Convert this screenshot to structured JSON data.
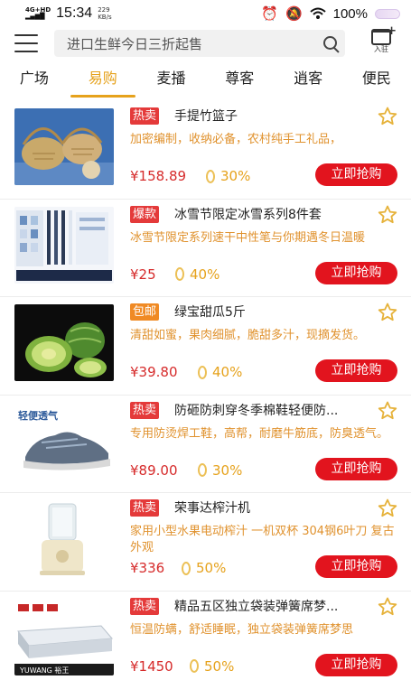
{
  "status_bar": {
    "network": "4G+HD",
    "time": "15:34",
    "speed_value": "229",
    "speed_unit": "KB/s",
    "battery": "100%"
  },
  "header": {
    "search_placeholder": "进口生鲜今日三折起售",
    "join_label": "入驻"
  },
  "tabs": [
    {
      "label": "广场"
    },
    {
      "label": "易购"
    },
    {
      "label": "麦播"
    },
    {
      "label": "尊客"
    },
    {
      "label": "逍客"
    },
    {
      "label": "便民"
    }
  ],
  "active_tab": "易购",
  "colors": {
    "accent": "#e6a21c",
    "buy_button": "#e2141e",
    "price": "#d62b2b",
    "badge_red": "#e43a3a",
    "badge_orange": "#f08a24"
  },
  "buy_label": "立即抢购",
  "products": [
    {
      "badge": "热卖",
      "title": "手提竹篮子",
      "desc": "加密编制，收纳必备，农村纯手工礼品，",
      "price": "¥158.89",
      "rate": "30%"
    },
    {
      "badge": "爆款",
      "title": "冰雪节限定冰雪系列8件套",
      "desc": "冰雪节限定系列速干中性笔与你期遇冬日温暖",
      "price": "¥25",
      "rate": "40%"
    },
    {
      "badge": "包邮",
      "title": "绿宝甜瓜5斤",
      "desc": "清甜如蜜，果肉细腻，脆甜多汁，现摘发货。",
      "price": "¥39.80",
      "rate": "40%"
    },
    {
      "badge": "热卖",
      "title": "防砸防刺穿冬季棉鞋轻便防...",
      "desc": "专用防烫焊工鞋，高帮，耐磨牛筋底，防臭透气。",
      "price": "¥89.00",
      "rate": "30%"
    },
    {
      "badge": "热卖",
      "title": "荣事达榨汁机",
      "desc": "家用小型水果电动榨汁 一机双杯 304钢6叶刀 复古外观",
      "price": "¥336",
      "rate": "50%"
    },
    {
      "badge": "热卖",
      "title": "精品五区独立袋装弹簧席梦...",
      "desc": "恒温防螨，舒适睡眠，独立袋装弹簧席梦思",
      "price": "¥1450",
      "rate": "50%"
    }
  ],
  "images": {
    "shoe_text": "轻便透气",
    "mattress_brand": "YUWANG 裕王"
  }
}
